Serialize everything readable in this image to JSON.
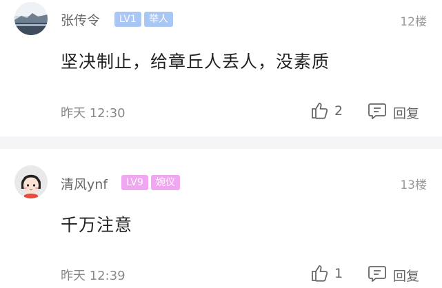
{
  "colors": {
    "lv1_badge": "#a9c7f5",
    "lv9_badge": "#f0a6f0",
    "text_gray": "#888888",
    "divider": "#f5f5f7"
  },
  "comments": [
    {
      "username": "张传令",
      "level": "LV1",
      "title": "举人",
      "floor": "12楼",
      "content": "坚决制止，给章丘人丢人，没素质",
      "time": "昨天 12:30",
      "likes": "2",
      "reply_label": "回复",
      "avatar_icon": "landscape-avatar"
    },
    {
      "username": "清风ynf",
      "level": "LV9",
      "title": "婉仪",
      "floor": "13楼",
      "content": "千万注意",
      "time": "昨天 12:39",
      "likes": "1",
      "reply_label": "回复",
      "avatar_icon": "cartoon-girl-avatar"
    }
  ]
}
